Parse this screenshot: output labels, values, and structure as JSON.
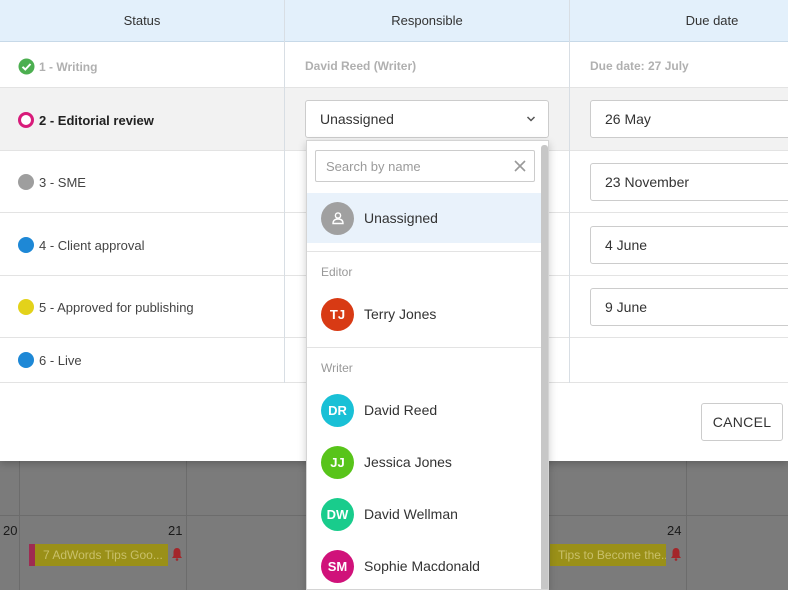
{
  "table": {
    "headers": {
      "status": "Status",
      "responsible": "Responsible",
      "due_date": "Due date"
    },
    "rows": [
      {
        "label": "1 - Writing",
        "responsible": "David Reed (Writer)",
        "due": "Due date: 27 July",
        "dot_color": "#4caf50"
      },
      {
        "label": "2 - Editorial review",
        "responsible": "Unassigned",
        "due": "26 May",
        "dot_color": "#d81b7a"
      },
      {
        "label": "3 - SME",
        "due": "23 November",
        "dot_color": "#9e9e9e"
      },
      {
        "label": "4 - Client approval",
        "due": "4 June",
        "dot_color": "#1e88d6"
      },
      {
        "label": "5 - Approved for publishing",
        "due": "9 June",
        "dot_color": "#e3d21a"
      },
      {
        "label": "6 - Live",
        "dot_color": "#1e88d6"
      }
    ]
  },
  "dialog": {
    "cancel_label": "CANCEL"
  },
  "dropdown": {
    "search_placeholder": "Search by name",
    "unassigned_label": "Unassigned",
    "groups": [
      {
        "name": "Editor",
        "people": [
          {
            "initials": "TJ",
            "name": "Terry Jones",
            "color": "#d83a14"
          }
        ]
      },
      {
        "name": "Writer",
        "people": [
          {
            "initials": "DR",
            "name": "David Reed",
            "color": "#19c0d6"
          },
          {
            "initials": "JJ",
            "name": "Jessica Jones",
            "color": "#58c41a"
          },
          {
            "initials": "DW",
            "name": "David Wellman",
            "color": "#19cc8c"
          },
          {
            "initials": "SM",
            "name": "Sophie Macdonald",
            "color": "#d0127a"
          }
        ]
      }
    ]
  },
  "calendar": {
    "days": [
      "20",
      "21",
      "24"
    ],
    "events": [
      {
        "title": "7 AdWords Tips Goo..."
      },
      {
        "title": "Tips to Become the..."
      }
    ]
  },
  "colors": {
    "header_bg": "#e3f0fb",
    "selected_option_bg": "#e9f2fb",
    "event_bg": "#9a9018"
  }
}
